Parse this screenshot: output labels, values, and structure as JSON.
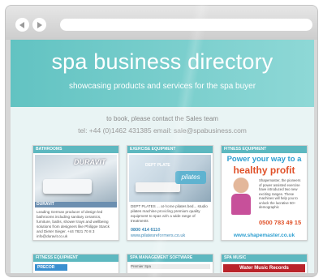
{
  "browser": {
    "back_icon": "chevron-left-icon",
    "forward_icon": "chevron-right-icon"
  },
  "hero": {
    "title_light": "spa business",
    "title_bold": "directory",
    "subtitle": "showcasing products and services for the spa buyer"
  },
  "contact": {
    "line1": "to book, please contact the Sales team",
    "line2": "tel: +44 (0)1462 431385  email: sale@spabusiness.com"
  },
  "cards": [
    {
      "category": "BATHROOMS",
      "brand": "DURAVIT",
      "tag": "DURAVIT",
      "text": "Leading German producer of design-led bathrooms including sanitary ceramics, furniture, baths, shower trays and wellbeing solutions from designers like Philippe Starck and Dieter Sieger. +44 7821 70 8 3 info@duravit.co.uk"
    },
    {
      "category": "EXERCISE EQUIPMENT",
      "mini": "DEPT PLATE",
      "brand": "pilates",
      "text": "DEPT PLATES ... at-home pilates bed... studio pilates machine providing premium quality equipment to spas with a wide range of treatments",
      "phone": "0800 414 6110",
      "url": "www.pilatesreformers.co.uk"
    },
    {
      "category": "FITNESS EQUIPMENT",
      "headline1": "Power your way to a",
      "headline2": "healthy profit",
      "text": "Shapemaster, the pioneers of power assisted exercise have introduced two new exciting ranges. These machines will help you to unlock the lucrative 50+ demographic",
      "phone": "0500 783 49 15",
      "url": "www.shapemaster.co.uk"
    },
    {
      "category": "FITNESS EQUIPMENT",
      "brand": "PRECOR"
    },
    {
      "category": "SPA MANAGEMENT SOFTWARE",
      "text": "Premier Spa"
    },
    {
      "category": "SPA MUSIC",
      "brand": "Water Music Records"
    }
  ]
}
